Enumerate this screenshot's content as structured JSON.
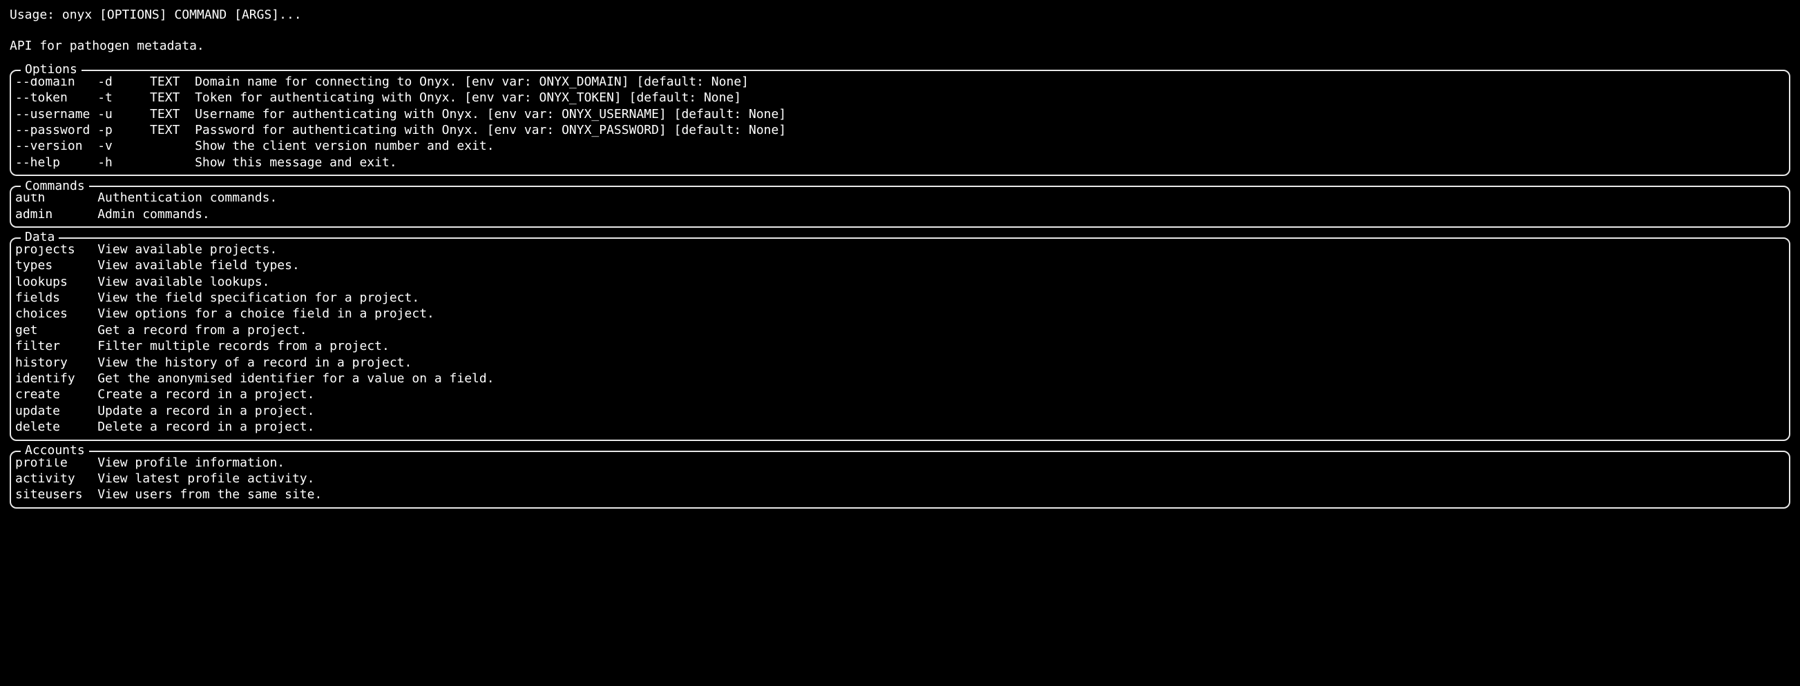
{
  "usage": "Usage: onyx [OPTIONS] COMMAND [ARGS]...",
  "description": "API for pathogen metadata.",
  "options": {
    "title": "Options",
    "rows": [
      {
        "long": "--domain",
        "short": "-d",
        "type": "TEXT",
        "desc": "Domain name for connecting to Onyx. [env var: ONYX_DOMAIN] [default: None]"
      },
      {
        "long": "--token",
        "short": "-t",
        "type": "TEXT",
        "desc": "Token for authenticating with Onyx. [env var: ONYX_TOKEN] [default: None]"
      },
      {
        "long": "--username",
        "short": "-u",
        "type": "TEXT",
        "desc": "Username for authenticating with Onyx. [env var: ONYX_USERNAME] [default: None]"
      },
      {
        "long": "--password",
        "short": "-p",
        "type": "TEXT",
        "desc": "Password for authenticating with Onyx. [env var: ONYX_PASSWORD] [default: None]"
      },
      {
        "long": "--version",
        "short": "-v",
        "type": "",
        "desc": "Show the client version number and exit."
      },
      {
        "long": "--help",
        "short": "-h",
        "type": "",
        "desc": "Show this message and exit."
      }
    ]
  },
  "commands": {
    "title": "Commands",
    "rows": [
      {
        "cmd": "auth",
        "desc": "Authentication commands."
      },
      {
        "cmd": "admin",
        "desc": "Admin commands."
      }
    ]
  },
  "data": {
    "title": "Data",
    "rows": [
      {
        "cmd": "projects",
        "desc": "View available projects."
      },
      {
        "cmd": "types",
        "desc": "View available field types."
      },
      {
        "cmd": "lookups",
        "desc": "View available lookups."
      },
      {
        "cmd": "fields",
        "desc": "View the field specification for a project."
      },
      {
        "cmd": "choices",
        "desc": "View options for a choice field in a project."
      },
      {
        "cmd": "get",
        "desc": "Get a record from a project."
      },
      {
        "cmd": "filter",
        "desc": "Filter multiple records from a project."
      },
      {
        "cmd": "history",
        "desc": "View the history of a record in a project."
      },
      {
        "cmd": "identify",
        "desc": "Get the anonymised identifier for a value on a field."
      },
      {
        "cmd": "create",
        "desc": "Create a record in a project."
      },
      {
        "cmd": "update",
        "desc": "Update a record in a project."
      },
      {
        "cmd": "delete",
        "desc": "Delete a record in a project."
      }
    ]
  },
  "accounts": {
    "title": "Accounts",
    "rows": [
      {
        "cmd": "profile",
        "desc": "View profile information."
      },
      {
        "cmd": "activity",
        "desc": "View latest profile activity."
      },
      {
        "cmd": "siteusers",
        "desc": "View users from the same site."
      }
    ]
  }
}
